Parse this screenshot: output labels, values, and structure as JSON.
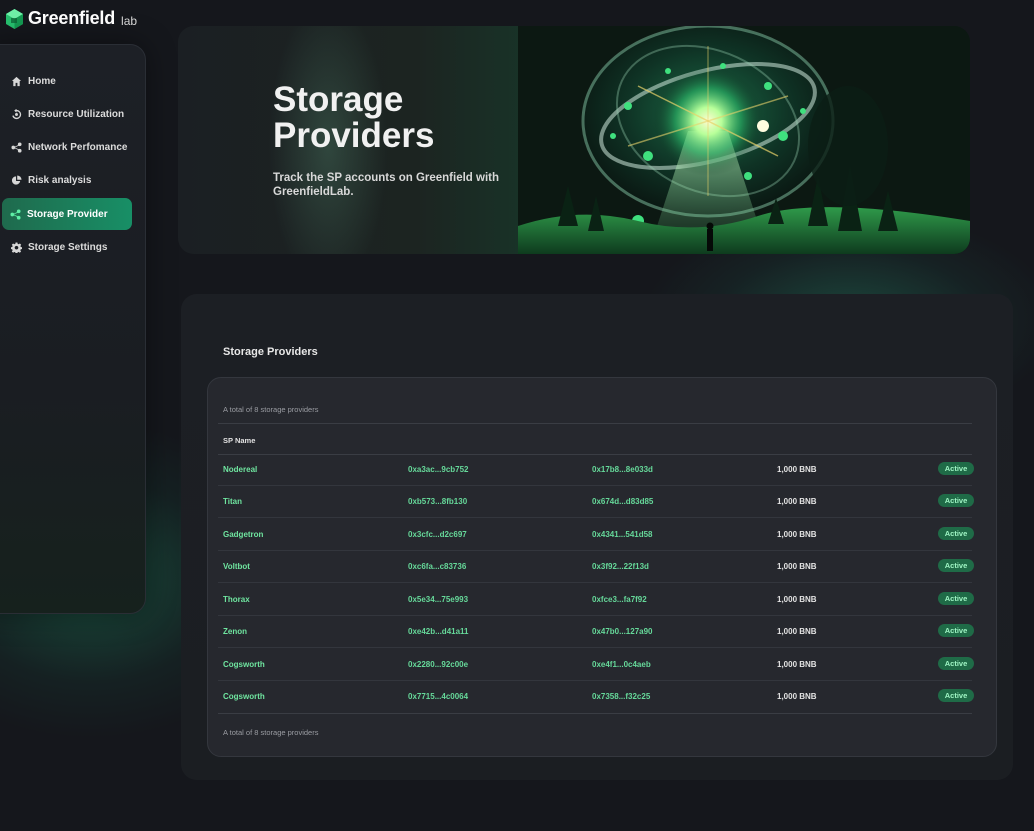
{
  "brand": {
    "name": "Greenfield",
    "suffix": "lab"
  },
  "sidebar": {
    "items": [
      {
        "label": "Home",
        "icon": "home-icon",
        "active": false
      },
      {
        "label": "Resource Utilization",
        "icon": "recycle-icon",
        "active": false
      },
      {
        "label": "Network Perfomance",
        "icon": "share-icon",
        "active": false
      },
      {
        "label": "Risk analysis",
        "icon": "pie-chart-icon",
        "active": false
      },
      {
        "label": "Storage Provider",
        "icon": "share-icon",
        "active": true
      },
      {
        "label": "Storage Settings",
        "icon": "gear-icon",
        "active": false
      }
    ]
  },
  "hero": {
    "title": "Storage Providers",
    "subtitle": "Track the SP accounts on Greenfield with GreenfieldLab."
  },
  "panel": {
    "title": "Storage Providers",
    "total_top": "A total of 8 storage providers",
    "total_bottom": "A total of 8 storage providers",
    "header": {
      "name": "SP Name"
    },
    "rows": [
      {
        "name": "Nodereal",
        "addr1": "0xa3ac...9cb752",
        "addr2": "0x17b8...8e033d",
        "balance": "1,000 BNB",
        "status": "Active"
      },
      {
        "name": "Titan",
        "addr1": "0xb573...8fb130",
        "addr2": "0x674d...d83d85",
        "balance": "1,000 BNB",
        "status": "Active"
      },
      {
        "name": "Gadgetron",
        "addr1": "0x3cfc...d2c697",
        "addr2": "0x4341...541d58",
        "balance": "1,000 BNB",
        "status": "Active"
      },
      {
        "name": "Voltbot",
        "addr1": "0xc6fa...c83736",
        "addr2": "0x3f92...22f13d",
        "balance": "1,000 BNB",
        "status": "Active"
      },
      {
        "name": "Thorax",
        "addr1": "0x5e34...75e993",
        "addr2": "0xfce3...fa7f92",
        "balance": "1,000 BNB",
        "status": "Active"
      },
      {
        "name": "Zenon",
        "addr1": "0xe42b...d41a11",
        "addr2": "0x47b0...127a90",
        "balance": "1,000 BNB",
        "status": "Active"
      },
      {
        "name": "Cogsworth",
        "addr1": "0x2280...92c00e",
        "addr2": "0xe4f1...0c4aeb",
        "balance": "1,000 BNB",
        "status": "Active"
      },
      {
        "name": "Cogsworth",
        "addr1": "0x7715...4c0064",
        "addr2": "0x7358...f32c25",
        "balance": "1,000 BNB",
        "status": "Active"
      }
    ]
  },
  "colors": {
    "accent": "#1f8f66",
    "address": "#66d99a",
    "badge": "#1f6b47"
  }
}
